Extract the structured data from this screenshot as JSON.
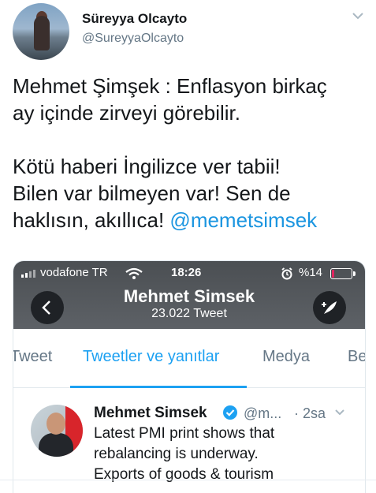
{
  "author": {
    "name": "Süreyya Olcayto",
    "handle": "@SureyyaOlcayto"
  },
  "tweet": {
    "line1": "Mehmet Şimşek : Enflasyon birkaç",
    "line2": "ay içinde zirveyi görebilir.",
    "line3": "Kötü haberi İngilizce ver tabii!",
    "line4": "Bilen var bilmeyen var! Sen de",
    "line5": "haklısın, akıllıca! ",
    "mention": "@memetsimsek"
  },
  "screenshot": {
    "status_bar": {
      "carrier": "vodafone TR",
      "time": "18:26",
      "battery": "%14",
      "battery_level": 0.14
    },
    "profile": {
      "name": "Mehmet Simsek",
      "tweet_count": "23.022 Tweet"
    },
    "tabs": [
      {
        "label": "Tweet"
      },
      {
        "label": "Tweetler ve yanıtlar"
      },
      {
        "label": "Medya"
      },
      {
        "label": "Beğeni"
      }
    ],
    "inner_tweet": {
      "name": "Mehmet Simsek",
      "handle": "@m...",
      "time": "· 2sa",
      "lines": [
        "Latest PMI print shows that",
        "rebalancing is underway.",
        "Exports of goods & tourism"
      ]
    }
  },
  "colors": {
    "accent": "#1da1f2",
    "mention": "#1b95e0",
    "muted": "#657786",
    "header_bg": "#4b4f53"
  }
}
